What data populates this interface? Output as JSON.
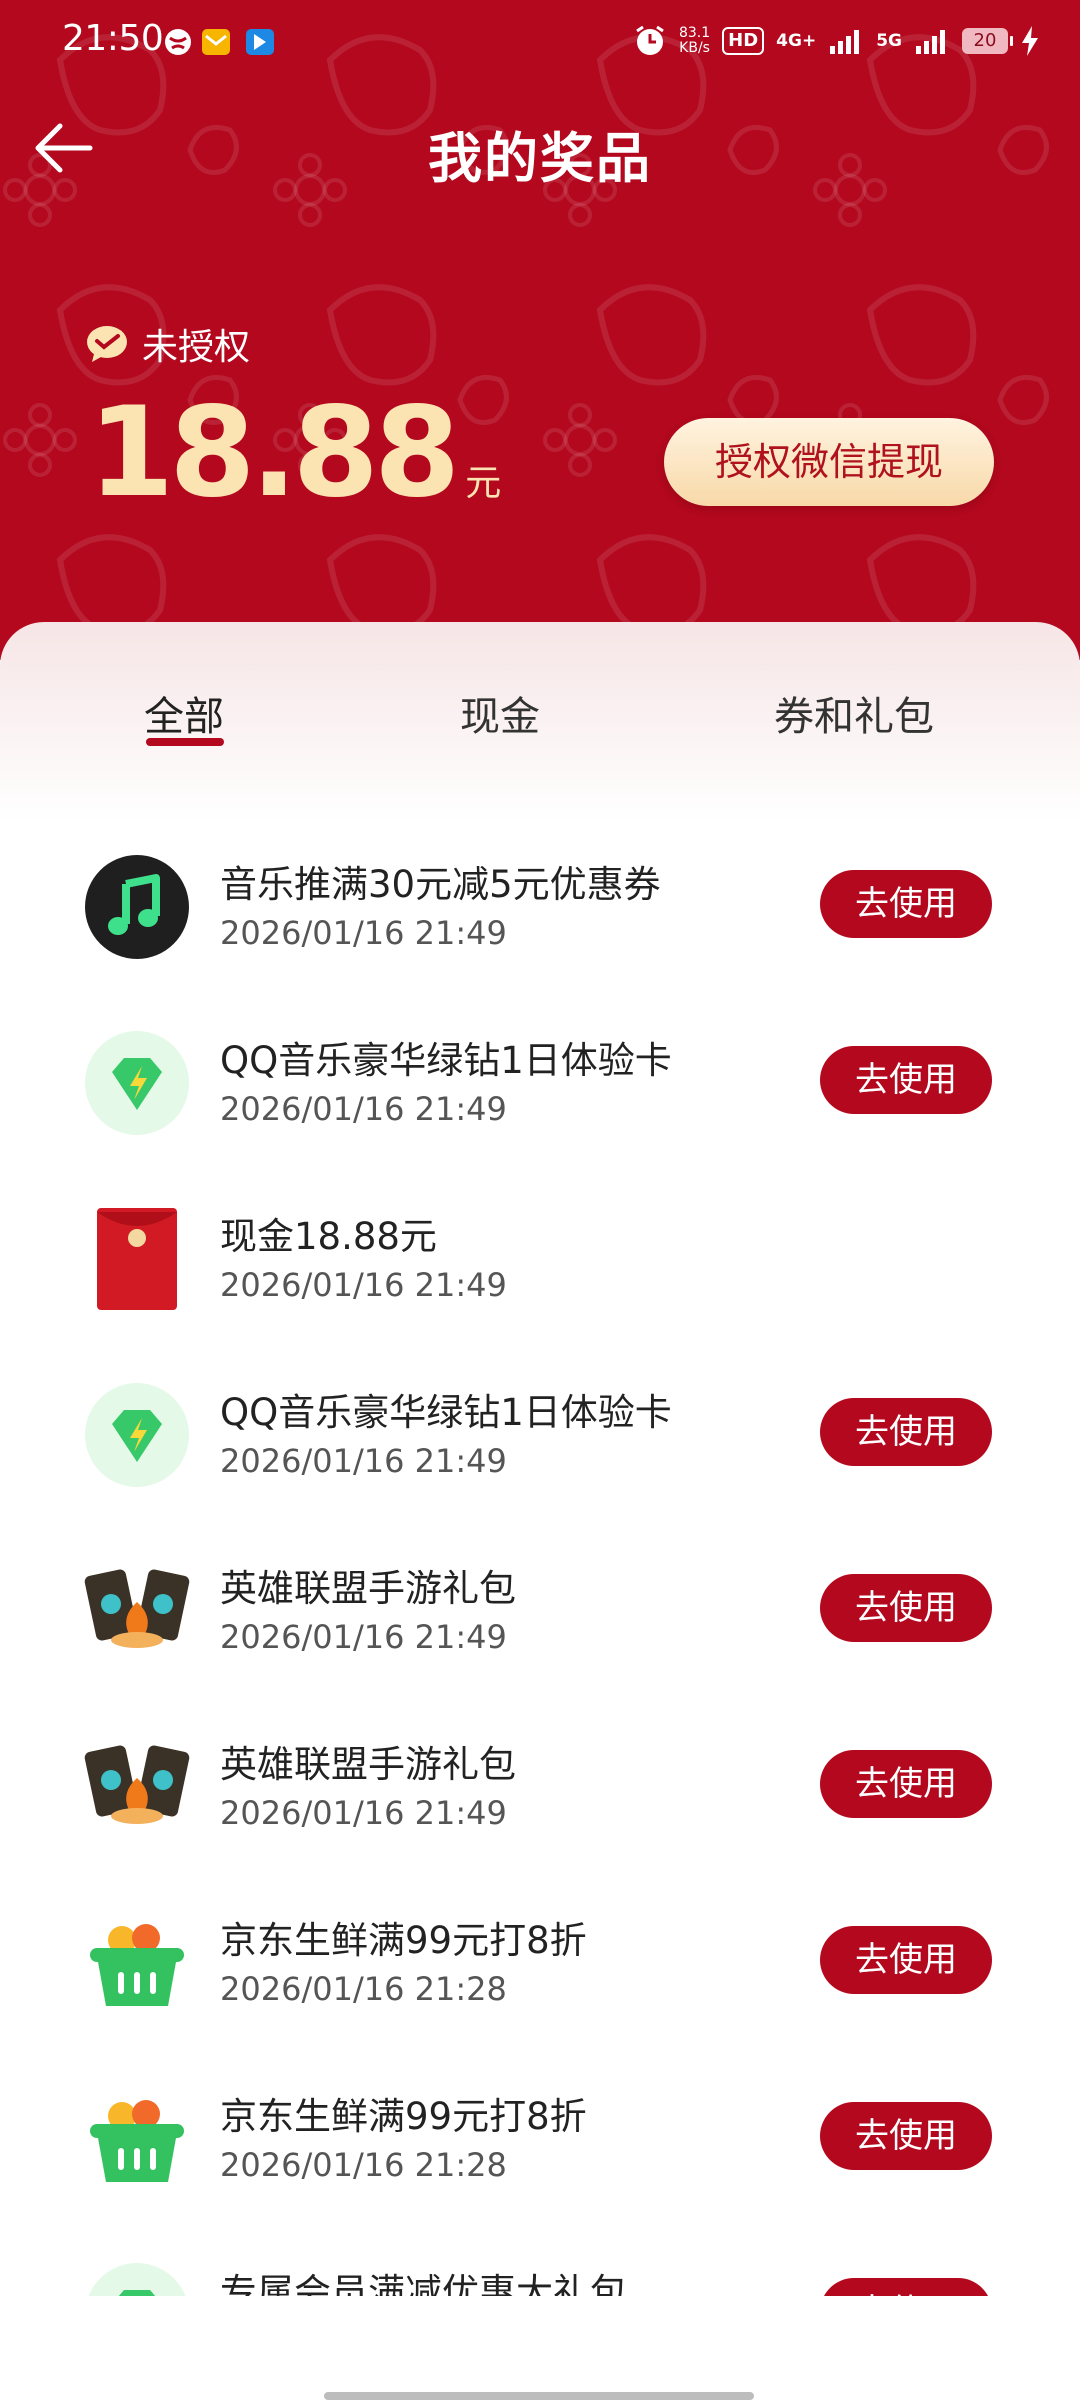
{
  "status_bar": {
    "time": "21:50",
    "speed_top": "83.1",
    "speed_unit": "KB/s",
    "hd_label": "HD",
    "net_4g": "4G+",
    "net_5g": "5G",
    "battery_level": "20",
    "icons": [
      "globe-icon",
      "mail-app-icon",
      "pin-app-icon",
      "alarm-icon",
      "signal-icon",
      "charging-icon"
    ]
  },
  "header": {
    "title": "我的奖品",
    "back_icon": "back-arrow-icon"
  },
  "account": {
    "auth_status": "未授权",
    "amount": "18.88",
    "unit": "元",
    "withdraw_label": "授权微信提现",
    "auth_icon": "wechat-icon"
  },
  "tabs": [
    {
      "label": "全部",
      "active": true
    },
    {
      "label": "现金",
      "active": false
    },
    {
      "label": "券和礼包",
      "active": false
    }
  ],
  "colors": {
    "brand_red": "#b3081e",
    "gold_text": "#fbe3b2"
  },
  "prizes": [
    {
      "title": "音乐推满30元减5元优惠券",
      "time": "2026/01/16 21:49",
      "action": "去使用",
      "icon": "music-note-icon"
    },
    {
      "title": "QQ音乐豪华绿钻1日体验卡",
      "time": "2026/01/16 21:49",
      "action": "去使用",
      "icon": "green-diamond-icon"
    },
    {
      "title": "现金18.88元",
      "time": "2026/01/16 21:49",
      "action": "",
      "icon": "red-envelope-icon"
    },
    {
      "title": "QQ音乐豪华绿钻1日体验卡",
      "time": "2026/01/16 21:49",
      "action": "去使用",
      "icon": "green-diamond-icon"
    },
    {
      "title": "英雄联盟手游礼包",
      "time": "2026/01/16 21:49",
      "action": "去使用",
      "icon": "game-cards-icon"
    },
    {
      "title": "英雄联盟手游礼包",
      "time": "2026/01/16 21:49",
      "action": "去使用",
      "icon": "game-cards-icon"
    },
    {
      "title": "京东生鲜满99元打8折",
      "time": "2026/01/16 21:28",
      "action": "去使用",
      "icon": "grocery-basket-icon"
    },
    {
      "title": "京东生鲜满99元打8折",
      "time": "2026/01/16 21:28",
      "action": "去使用",
      "icon": "grocery-basket-icon"
    },
    {
      "title": "专属会员满减优惠大礼包",
      "time": "",
      "action": "去使用",
      "icon": "green-diamond-icon"
    }
  ]
}
